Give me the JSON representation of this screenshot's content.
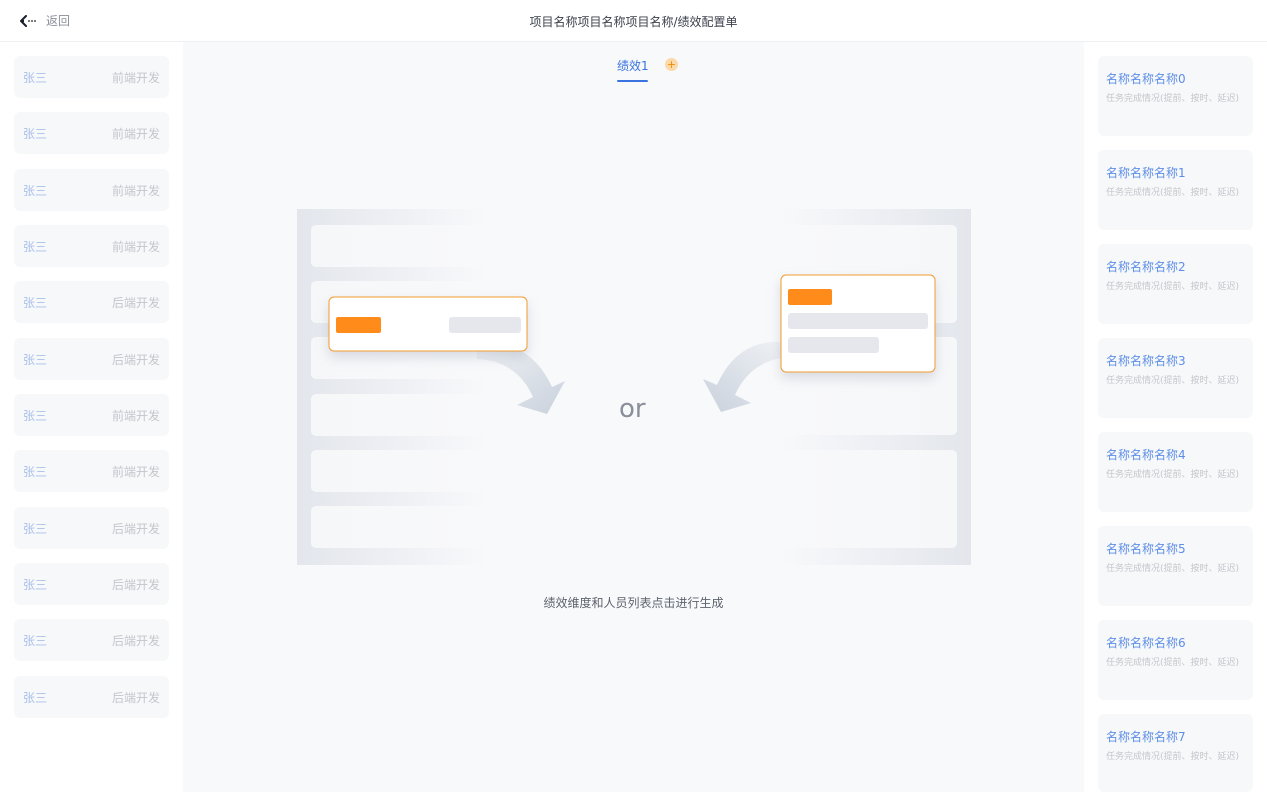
{
  "header": {
    "back_label": "返回",
    "title": "项目名称项目名称项目名称/绩效配置单"
  },
  "people": [
    {
      "name": "张三",
      "role": "前端开发"
    },
    {
      "name": "张三",
      "role": "前端开发"
    },
    {
      "name": "张三",
      "role": "前端开发"
    },
    {
      "name": "张三",
      "role": "前端开发"
    },
    {
      "name": "张三",
      "role": "后端开发"
    },
    {
      "name": "张三",
      "role": "后端开发"
    },
    {
      "name": "张三",
      "role": "前端开发"
    },
    {
      "name": "张三",
      "role": "前端开发"
    },
    {
      "name": "张三",
      "role": "后端开发"
    },
    {
      "name": "张三",
      "role": "后端开发"
    },
    {
      "name": "张三",
      "role": "后端开发"
    },
    {
      "name": "张三",
      "role": "后端开发"
    }
  ],
  "center": {
    "tab_label": "绩效1",
    "add_icon": "plus-circle-icon",
    "or_text": "or",
    "hint": "绩效维度和人员列表点击进行生成"
  },
  "dimensions": [
    {
      "name": "名称名称名称0",
      "desc": "任务完成情况(提前、按时、延迟)"
    },
    {
      "name": "名称名称名称1",
      "desc": "任务完成情况(提前、按时、延迟)"
    },
    {
      "name": "名称名称名称2",
      "desc": "任务完成情况(提前、按时、延迟)"
    },
    {
      "name": "名称名称名称3",
      "desc": "任务完成情况(提前、按时、延迟)"
    },
    {
      "name": "名称名称名称4",
      "desc": "任务完成情况(提前、按时、延迟)"
    },
    {
      "name": "名称名称名称5",
      "desc": "任务完成情况(提前、按时、延迟)"
    },
    {
      "name": "名称名称名称6",
      "desc": "任务完成情况(提前、按时、延迟)"
    },
    {
      "name": "名称名称名称7",
      "desc": "任务完成情况(提前、按时、延迟)"
    }
  ],
  "colors": {
    "accent": "#3a73e0",
    "orange": "#ff8c1a"
  }
}
